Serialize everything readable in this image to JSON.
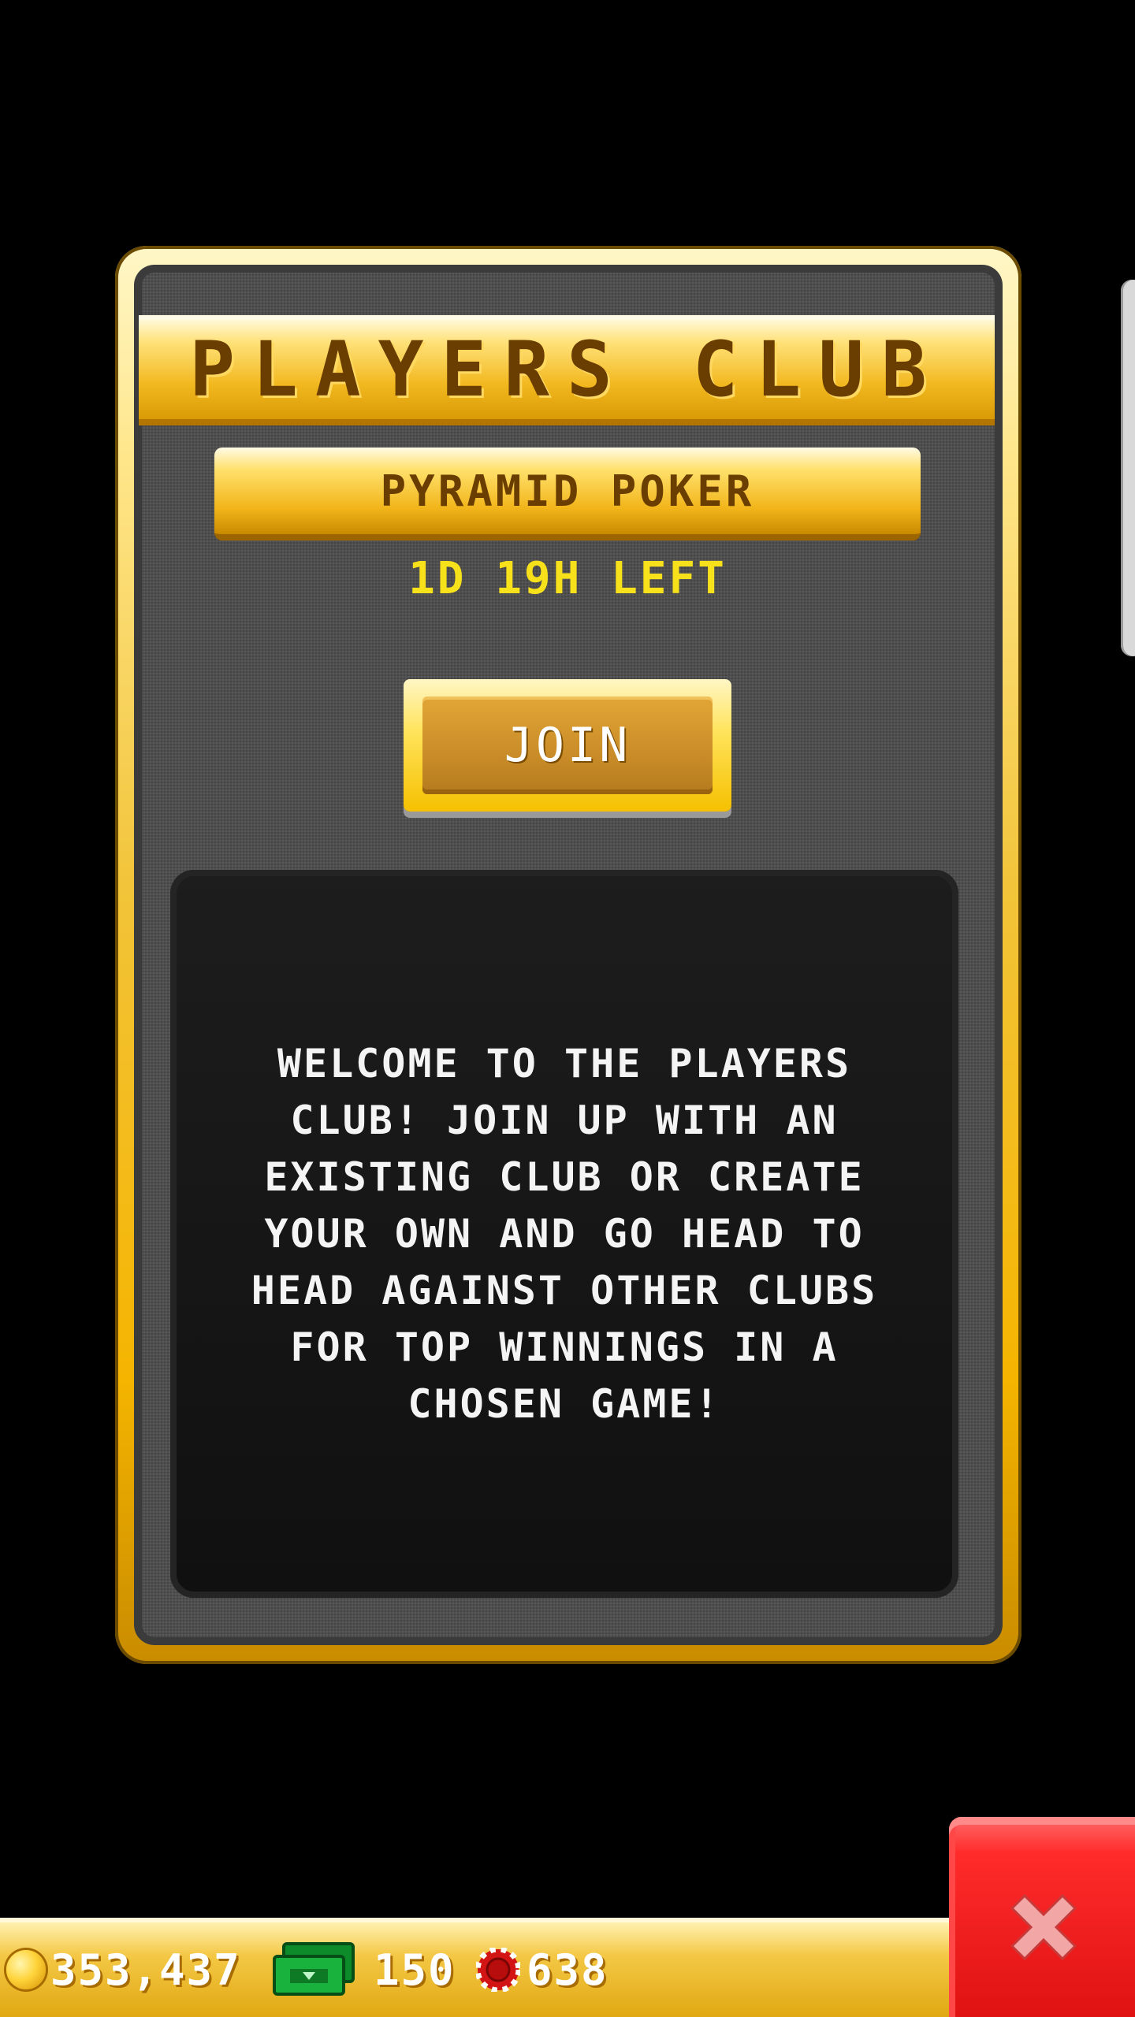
{
  "panel": {
    "title": "PLAYERS CLUB",
    "game_name": "PYRAMID POKER",
    "time_left": "1D 19H LEFT",
    "join_label": "JOIN",
    "description": "WELCOME TO THE PLAYERS CLUB! JOIN UP WITH AN EXISTING CLUB OR CREATE YOUR OWN AND GO HEAD TO HEAD AGAINST OTHER CLUBS FOR TOP WINNINGS IN A CHOSEN GAME!"
  },
  "currency": {
    "coins": "353,437",
    "cash": "150",
    "chips": "638"
  },
  "icons": {
    "coin": "coin-icon",
    "cash": "cash-icon",
    "chip": "chip-icon",
    "close": "close-icon"
  },
  "colors": {
    "gold": "#f2b81f",
    "title_text": "#6a3d00",
    "time_left": "#f7e11a",
    "close_red": "#e01212",
    "panel_gray": "#4c4c4c"
  }
}
